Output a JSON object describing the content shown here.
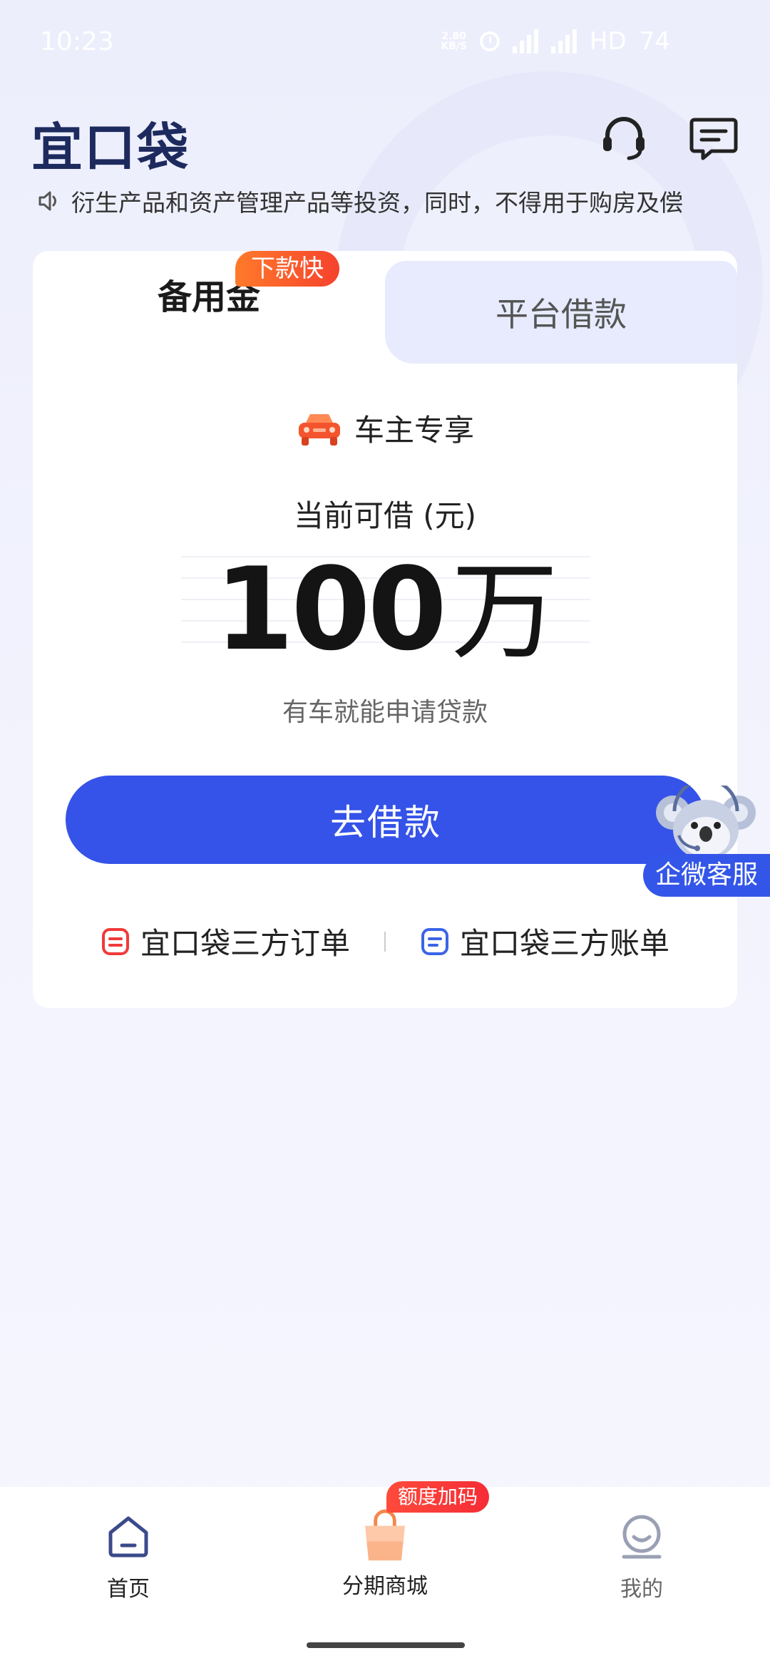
{
  "status_bar": {
    "time": "10:23",
    "net_speed_value": "2.80",
    "net_speed_unit": "KB/S",
    "hd_label": "HD",
    "battery": "74"
  },
  "header": {
    "logo_text": "宜口袋",
    "service_icon": "headset-icon",
    "message_icon": "message-icon"
  },
  "notice": {
    "icon": "speaker-icon",
    "text": "衍生产品和资产管理产品等投资，同时，不得用于购房及偿"
  },
  "tabs": {
    "active_label": "备用金",
    "active_badge": "下款快",
    "inactive_label": "平台借款"
  },
  "card": {
    "owner_label": "车主专享",
    "credit_label": "当前可借 (元)",
    "amount_value": "100",
    "amount_unit": "万",
    "amount_sub": "有车就能申请贷款",
    "borrow_button": "去借款",
    "link_orders": "宜口袋三方订单",
    "link_bills": "宜口袋三方账单"
  },
  "floating_service": {
    "label": "企微客服"
  },
  "bottom_nav": {
    "home_label": "首页",
    "mall_label": "分期商城",
    "mall_badge": "额度加码",
    "mine_label": "我的"
  },
  "colors": {
    "primary": "#3553e8",
    "badge_orange": "#f6422e",
    "nav_icon": "#3b4a8a",
    "mine_icon": "#9aa0b4"
  }
}
